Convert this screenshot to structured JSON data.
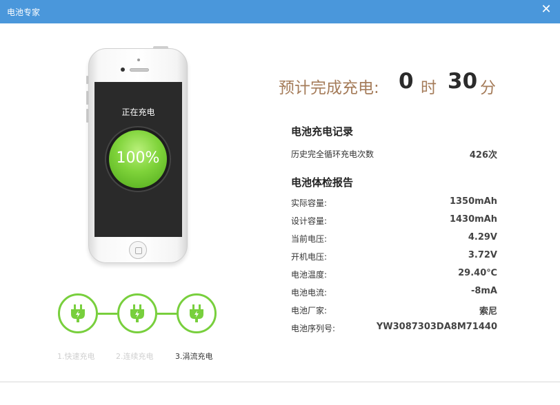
{
  "window": {
    "title": "电池专家",
    "close_label": "✕"
  },
  "phone": {
    "status_text": "正在充电",
    "battery_percent": "100%"
  },
  "steps": [
    {
      "label": "1.快速充电",
      "active": false
    },
    {
      "label": "2.连续充电",
      "active": false
    },
    {
      "label": "3.涓流充电",
      "active": true
    }
  ],
  "eta": {
    "label": "预计完成充电:",
    "hours": "0",
    "hours_unit": "时",
    "minutes": "30",
    "minutes_unit": "分"
  },
  "charge_record": {
    "title": "电池充电记录",
    "rows": [
      {
        "label": "历史完全循环充电次数",
        "value": "426次"
      }
    ]
  },
  "health_report": {
    "title": "电池体检报告",
    "rows": [
      {
        "label": "实际容量:",
        "value": "1350mAh"
      },
      {
        "label": "设计容量:",
        "value": "1430mAh"
      },
      {
        "label": "当前电压:",
        "value": "4.29V"
      },
      {
        "label": "开机电压:",
        "value": "3.72V"
      },
      {
        "label": "电池温度:",
        "value": "29.40℃"
      },
      {
        "label": "电池电流:",
        "value": "-8mA"
      },
      {
        "label": "电池厂家:",
        "value": "索尼"
      },
      {
        "label": "电池序列号:",
        "value": "YW3087303DA8M71440"
      }
    ]
  },
  "colors": {
    "titlebar": "#4a97db",
    "accent_green": "#78cf3d",
    "eta_brown": "#a57c5a"
  }
}
